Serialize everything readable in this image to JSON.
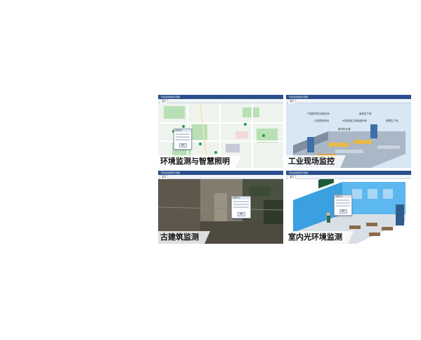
{
  "panels": [
    {
      "id": "env-smart-lighting",
      "caption": "环境监测与智慧照明",
      "window_title": "环境在线监测与控制",
      "tab": "首页"
    },
    {
      "id": "industrial-site",
      "caption": "工业现场监控",
      "window_title": "环境在线监测与控制",
      "tab": "首页",
      "scene_labels": [
        "气密型材料封装车间",
        "小型质检车间",
        "原材料仓储",
        "大型成组立体组装车间",
        "装修生产线",
        "修理生产线"
      ]
    },
    {
      "id": "ancient-building",
      "caption": "古建筑监测",
      "window_title": "环境在线监测与控制",
      "tab": "首页"
    },
    {
      "id": "indoor-light",
      "caption": "室内光环境监测",
      "window_title": "环境在线监测与控制",
      "tab": "首页"
    }
  ],
  "dialog": {
    "title": "设备信息",
    "button": "确定"
  },
  "colors": {
    "titlebar": "#2a4f8c",
    "map_bg": "#eef3ee",
    "map_green": "#b9e0b5",
    "industrial_bg": "#d7e7f4",
    "classroom_wall": "#3aa0e0"
  }
}
